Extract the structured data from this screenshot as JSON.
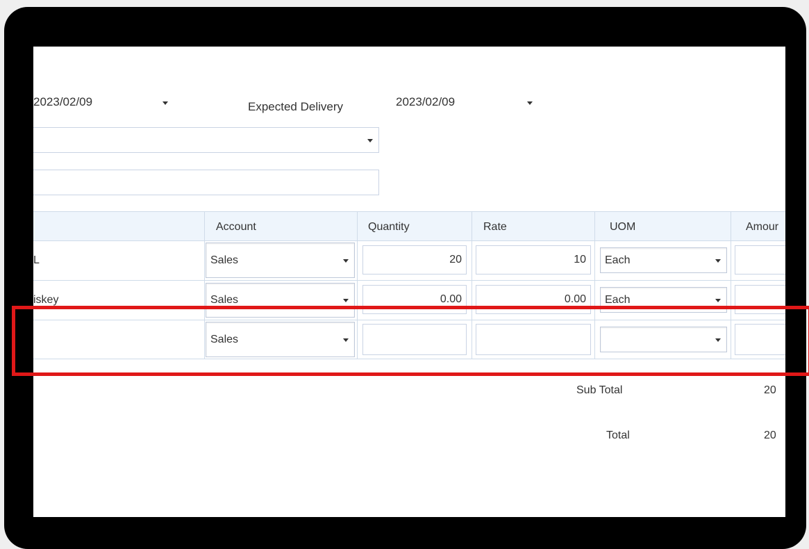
{
  "header": {
    "order_date": "2023/02/09",
    "expected_delivery_label": "Expected Delivery",
    "expected_delivery_date": "2023/02/09",
    "select_value": "",
    "text_value": ""
  },
  "table": {
    "columns": {
      "account": "Account",
      "quantity": "Quantity",
      "rate": "Rate",
      "uom": "UOM",
      "amount": "Amour"
    },
    "rows": [
      {
        "item": "L",
        "account": "Sales",
        "quantity": "20",
        "rate": "10",
        "uom": "Each"
      },
      {
        "item": "iskey",
        "account": "Sales",
        "quantity": "0.00",
        "rate": "0.00",
        "uom": "Each"
      },
      {
        "item": "",
        "account": "Sales",
        "quantity": "",
        "rate": "",
        "uom": ""
      }
    ]
  },
  "totals": {
    "subtotal_label": "Sub Total",
    "subtotal_value": "20",
    "total_label": "Total",
    "total_value": "20"
  },
  "colors": {
    "highlight": "#e01818",
    "header_bg": "#eef5fc",
    "border": "#cfdbe9"
  },
  "icons": [
    "caret-down-icon"
  ]
}
